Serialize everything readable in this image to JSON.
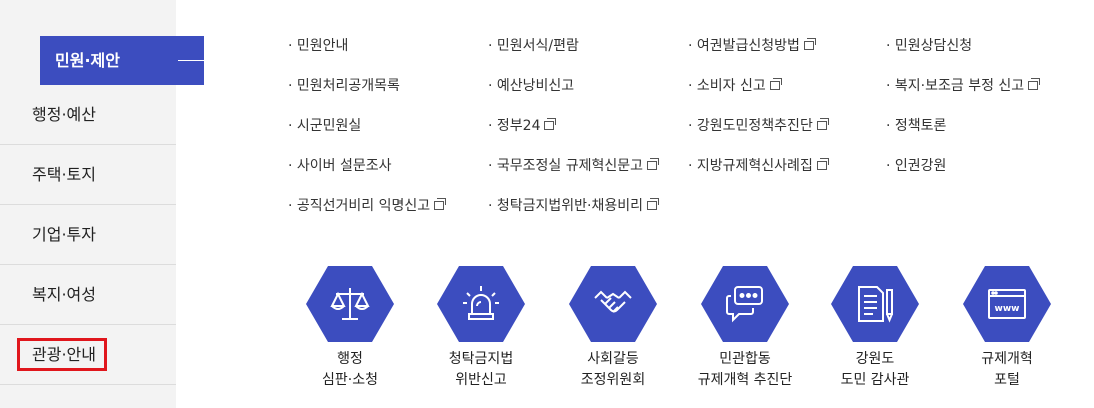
{
  "sidebar": {
    "active": "민원·제안",
    "items": [
      "행정·예산",
      "주택·토지",
      "기업·투자",
      "복지·여성",
      "관광·안내"
    ]
  },
  "links": [
    {
      "text": "· 민원안내",
      "ext": false
    },
    {
      "text": "· 민원서식/편람",
      "ext": false
    },
    {
      "text": "· 여권발급신청방법",
      "ext": true
    },
    {
      "text": "· 민원상담신청",
      "ext": false
    },
    {
      "text": "· 민원처리공개목록",
      "ext": false
    },
    {
      "text": "· 예산낭비신고",
      "ext": false
    },
    {
      "text": "· 소비자 신고",
      "ext": true
    },
    {
      "text": "· 복지·보조금 부정 신고",
      "ext": true
    },
    {
      "text": "· 시군민원실",
      "ext": false
    },
    {
      "text": "· 정부24",
      "ext": true
    },
    {
      "text": "· 강원도민정책추진단",
      "ext": true
    },
    {
      "text": "· 정책토론",
      "ext": false
    },
    {
      "text": "· 사이버 설문조사",
      "ext": false
    },
    {
      "text": "· 국무조정실 규제혁신문고",
      "ext": true
    },
    {
      "text": "· 지방규제혁신사례집",
      "ext": true
    },
    {
      "text": "· 인권강원",
      "ext": false
    },
    {
      "text": "· 공직선거비리 익명신고",
      "ext": true
    },
    {
      "text": "· 청탁금지법위반·채용비리",
      "ext": true
    }
  ],
  "icons": [
    {
      "icon": "scales-icon",
      "line1": "행정",
      "line2": "심판·소청"
    },
    {
      "icon": "siren-icon",
      "line1": "청탁금지법",
      "line2": "위반신고"
    },
    {
      "icon": "handshake-icon",
      "line1": "사회갈등",
      "line2": "조정위원회"
    },
    {
      "icon": "chat-icon",
      "line1": "민관합동",
      "line2": "규제개혁 추진단"
    },
    {
      "icon": "document-pen-icon",
      "line1": "강원도",
      "line2": "도민 감사관"
    },
    {
      "icon": "www-icon",
      "line1": "규제개혁",
      "line2": "포털"
    }
  ],
  "colors": {
    "accent": "#3c4dbf",
    "highlight": "#e0161c",
    "sidebar_bg": "#f3f3f3"
  }
}
